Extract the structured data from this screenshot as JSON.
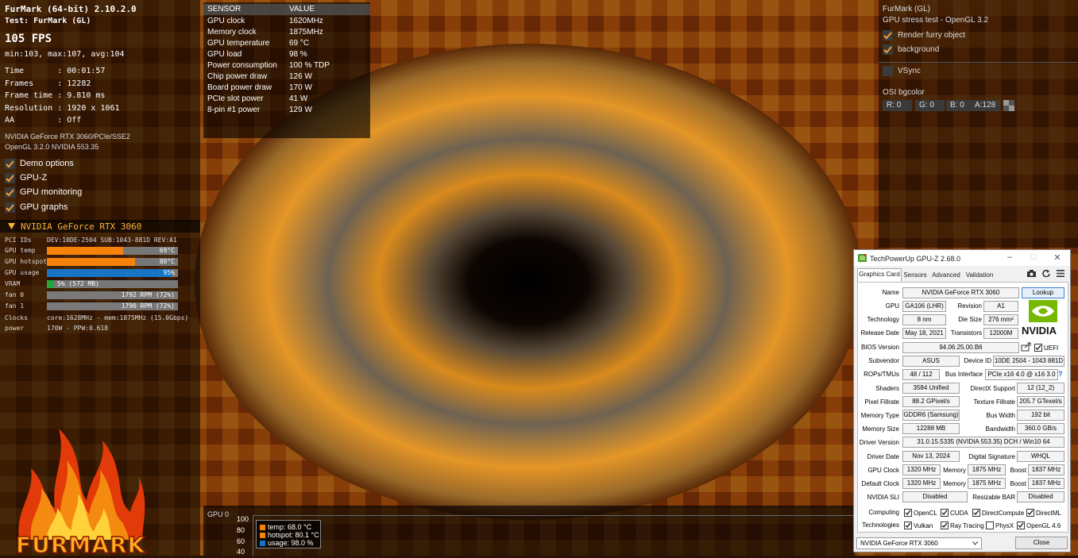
{
  "left_osd": {
    "title": "FurMark (64-bit) 2.10.2.0",
    "test": "Test: FurMark (GL)",
    "fps": "105 FPS",
    "fps_stats": "min:103, max:107, avg:104",
    "stats": [
      "Time       : 00:01:57",
      "Frames     : 12282",
      "Frame time : 9.810 ms",
      "Resolution : 1920 x 1061",
      "AA         : Off"
    ],
    "gpu_line": "NVIDIA GeForce RTX 3060/PCIe/SSE2",
    "gl_line": "OpenGL 3.2.0 NVIDIA 553.35",
    "options": [
      "Demo options",
      "GPU-Z",
      "GPU monitoring",
      "GPU graphs"
    ],
    "gpu_header": "NVIDIA GeForce RTX 3060",
    "pci_label": "PCI IDs",
    "pci_value": "DEV:10DE-2504 SUB:1043-881D REV:A1",
    "bars": [
      {
        "label": "GPU temp",
        "text": "69°C",
        "fraction": 0.58,
        "color": "#f5820a"
      },
      {
        "label": "GPU hotspot",
        "text": "80°C",
        "fraction": 0.67,
        "color": "#f5820a"
      },
      {
        "label": "GPU usage",
        "text": "95%",
        "fraction": 0.95,
        "color": "#1874c4"
      },
      {
        "label": "VRAM",
        "text": "5% (572 MB)",
        "fraction": 0.05,
        "color": "#24a638"
      },
      {
        "label": "fan 0",
        "text": "1792 RPM (72%)",
        "fraction": 0.72,
        "color": "#7a7a7a"
      },
      {
        "label": "fan 1",
        "text": "1790 RPM (72%)",
        "fraction": 0.72,
        "color": "#7a7a7a"
      }
    ],
    "clocks_label": "Clocks",
    "clocks_value": "core:1628MHz - mem:1875MHz (15.0Gbps)",
    "power_label": "power",
    "power_value": "170W - PPW:0.618",
    "logo_text": "FURMARK"
  },
  "sensor_table": {
    "headers": [
      "SENSOR",
      "VALUE"
    ],
    "rows": [
      [
        "GPU clock",
        "1620MHz"
      ],
      [
        "Memory clock",
        "1875MHz"
      ],
      [
        "GPU temperature",
        "69 °C"
      ],
      [
        "GPU load",
        "98 %"
      ],
      [
        "Power consumption",
        "100 % TDP"
      ],
      [
        "Chip power draw",
        "126 W"
      ],
      [
        "Board power draw",
        "170 W"
      ],
      [
        "PCIe slot power",
        "41 W"
      ],
      [
        "8-pin #1 power",
        "129 W"
      ]
    ]
  },
  "right_osd": {
    "title": "FurMark (GL)",
    "subtitle": "GPU stress test - OpenGL 3.2",
    "checks": [
      {
        "label": "Render furry object",
        "checked": true
      },
      {
        "label": "background",
        "checked": true
      },
      {
        "label": "VSync",
        "checked": false
      }
    ],
    "bgcolor_label": "OSI bgcolor",
    "rgba": [
      "R: 0",
      "G: 0",
      "B: 0",
      "A:128"
    ]
  },
  "graph": {
    "title": "GPU 0",
    "axis": [
      "100",
      "80",
      "60",
      "40"
    ],
    "legend": [
      {
        "label": "temp: 68.0 °C",
        "color": "#f5820a"
      },
      {
        "label": "hotspot: 80.1 °C",
        "color": "#f5820a"
      },
      {
        "label": "usage: 98.0 %",
        "color": "#1874c4"
      }
    ]
  },
  "gpuz": {
    "title": "TechPowerUp GPU-Z 2.68.0",
    "tabs": [
      "Graphics Card",
      "Sensors",
      "Advanced",
      "Validation"
    ],
    "name_label": "Name",
    "name": "NVIDIA GeForce RTX 3060",
    "lookup": "Lookup",
    "gpu_label": "GPU",
    "gpu": "GA106 (LHR)",
    "revision_label": "Revision",
    "revision": "A1",
    "tech_label": "Technology",
    "tech": "8 nm",
    "die_label": "Die Size",
    "die": "276 mm²",
    "release_label": "Release Date",
    "release": "May 18, 2021",
    "trans_label": "Transistors",
    "trans": "12000M",
    "bios_label": "BIOS Version",
    "bios": "94.06.25.00.B6",
    "uefi": "UEFI",
    "subvendor_label": "Subvendor",
    "subvendor": "ASUS",
    "device_label": "Device ID",
    "device": "10DE 2504 - 1043 881D",
    "rops_label": "ROPs/TMUs",
    "rops": "48 / 112",
    "bus_label": "Bus Interface",
    "bus": "PCIe x16 4.0 @ x16 3.0",
    "shaders_label": "Shaders",
    "shaders": "3584 Unified",
    "dx_label": "DirectX Support",
    "dx": "12 (12_2)",
    "pixel_label": "Pixel Fillrate",
    "pixel": "88.2 GPixel/s",
    "texture_label": "Texture Fillrate",
    "texture": "205.7 GTexel/s",
    "memtype_label": "Memory Type",
    "memtype": "GDDR6 (Samsung)",
    "buswidth_label": "Bus Width",
    "buswidth": "192 bit",
    "memsize_label": "Memory Size",
    "memsize": "12288 MB",
    "bandwidth_label": "Bandwidth",
    "bandwidth": "360.0 GB/s",
    "driver_label": "Driver Version",
    "driver": "31.0.15.5335 (NVIDIA 553.35) DCH / Win10 64",
    "driverdate_label": "Driver Date",
    "driverdate": "Nov 13, 2024",
    "sig_label": "Digital Signature",
    "sig": "WHQL",
    "gpuclock_label": "GPU Clock",
    "gpuclock": "1320 MHz",
    "memory_label": "Memory",
    "memclock": "1875 MHz",
    "boost_label": "Boost",
    "boost": "1837 MHz",
    "defclock_label": "Default Clock",
    "defclock": "1320 MHz",
    "defmem": "1875 MHz",
    "defboost": "1837 MHz",
    "sli_label": "NVIDIA SLI",
    "sli": "Disabled",
    "rebar_label": "Resizable BAR",
    "rebar": "Disabled",
    "computing_label": "Computing",
    "computing": [
      "OpenCL",
      "CUDA",
      "DirectCompute",
      "DirectML"
    ],
    "tech2_label": "Technologies",
    "technologies": [
      {
        "label": "Vulkan",
        "checked": true
      },
      {
        "label": "Ray Tracing",
        "checked": true
      },
      {
        "label": "PhysX",
        "checked": false
      },
      {
        "label": "OpenGL 4.6",
        "checked": true
      }
    ],
    "nvidia_logo": "NVIDIA",
    "select": "NVIDIA GeForce RTX 3060",
    "close": "Close"
  }
}
